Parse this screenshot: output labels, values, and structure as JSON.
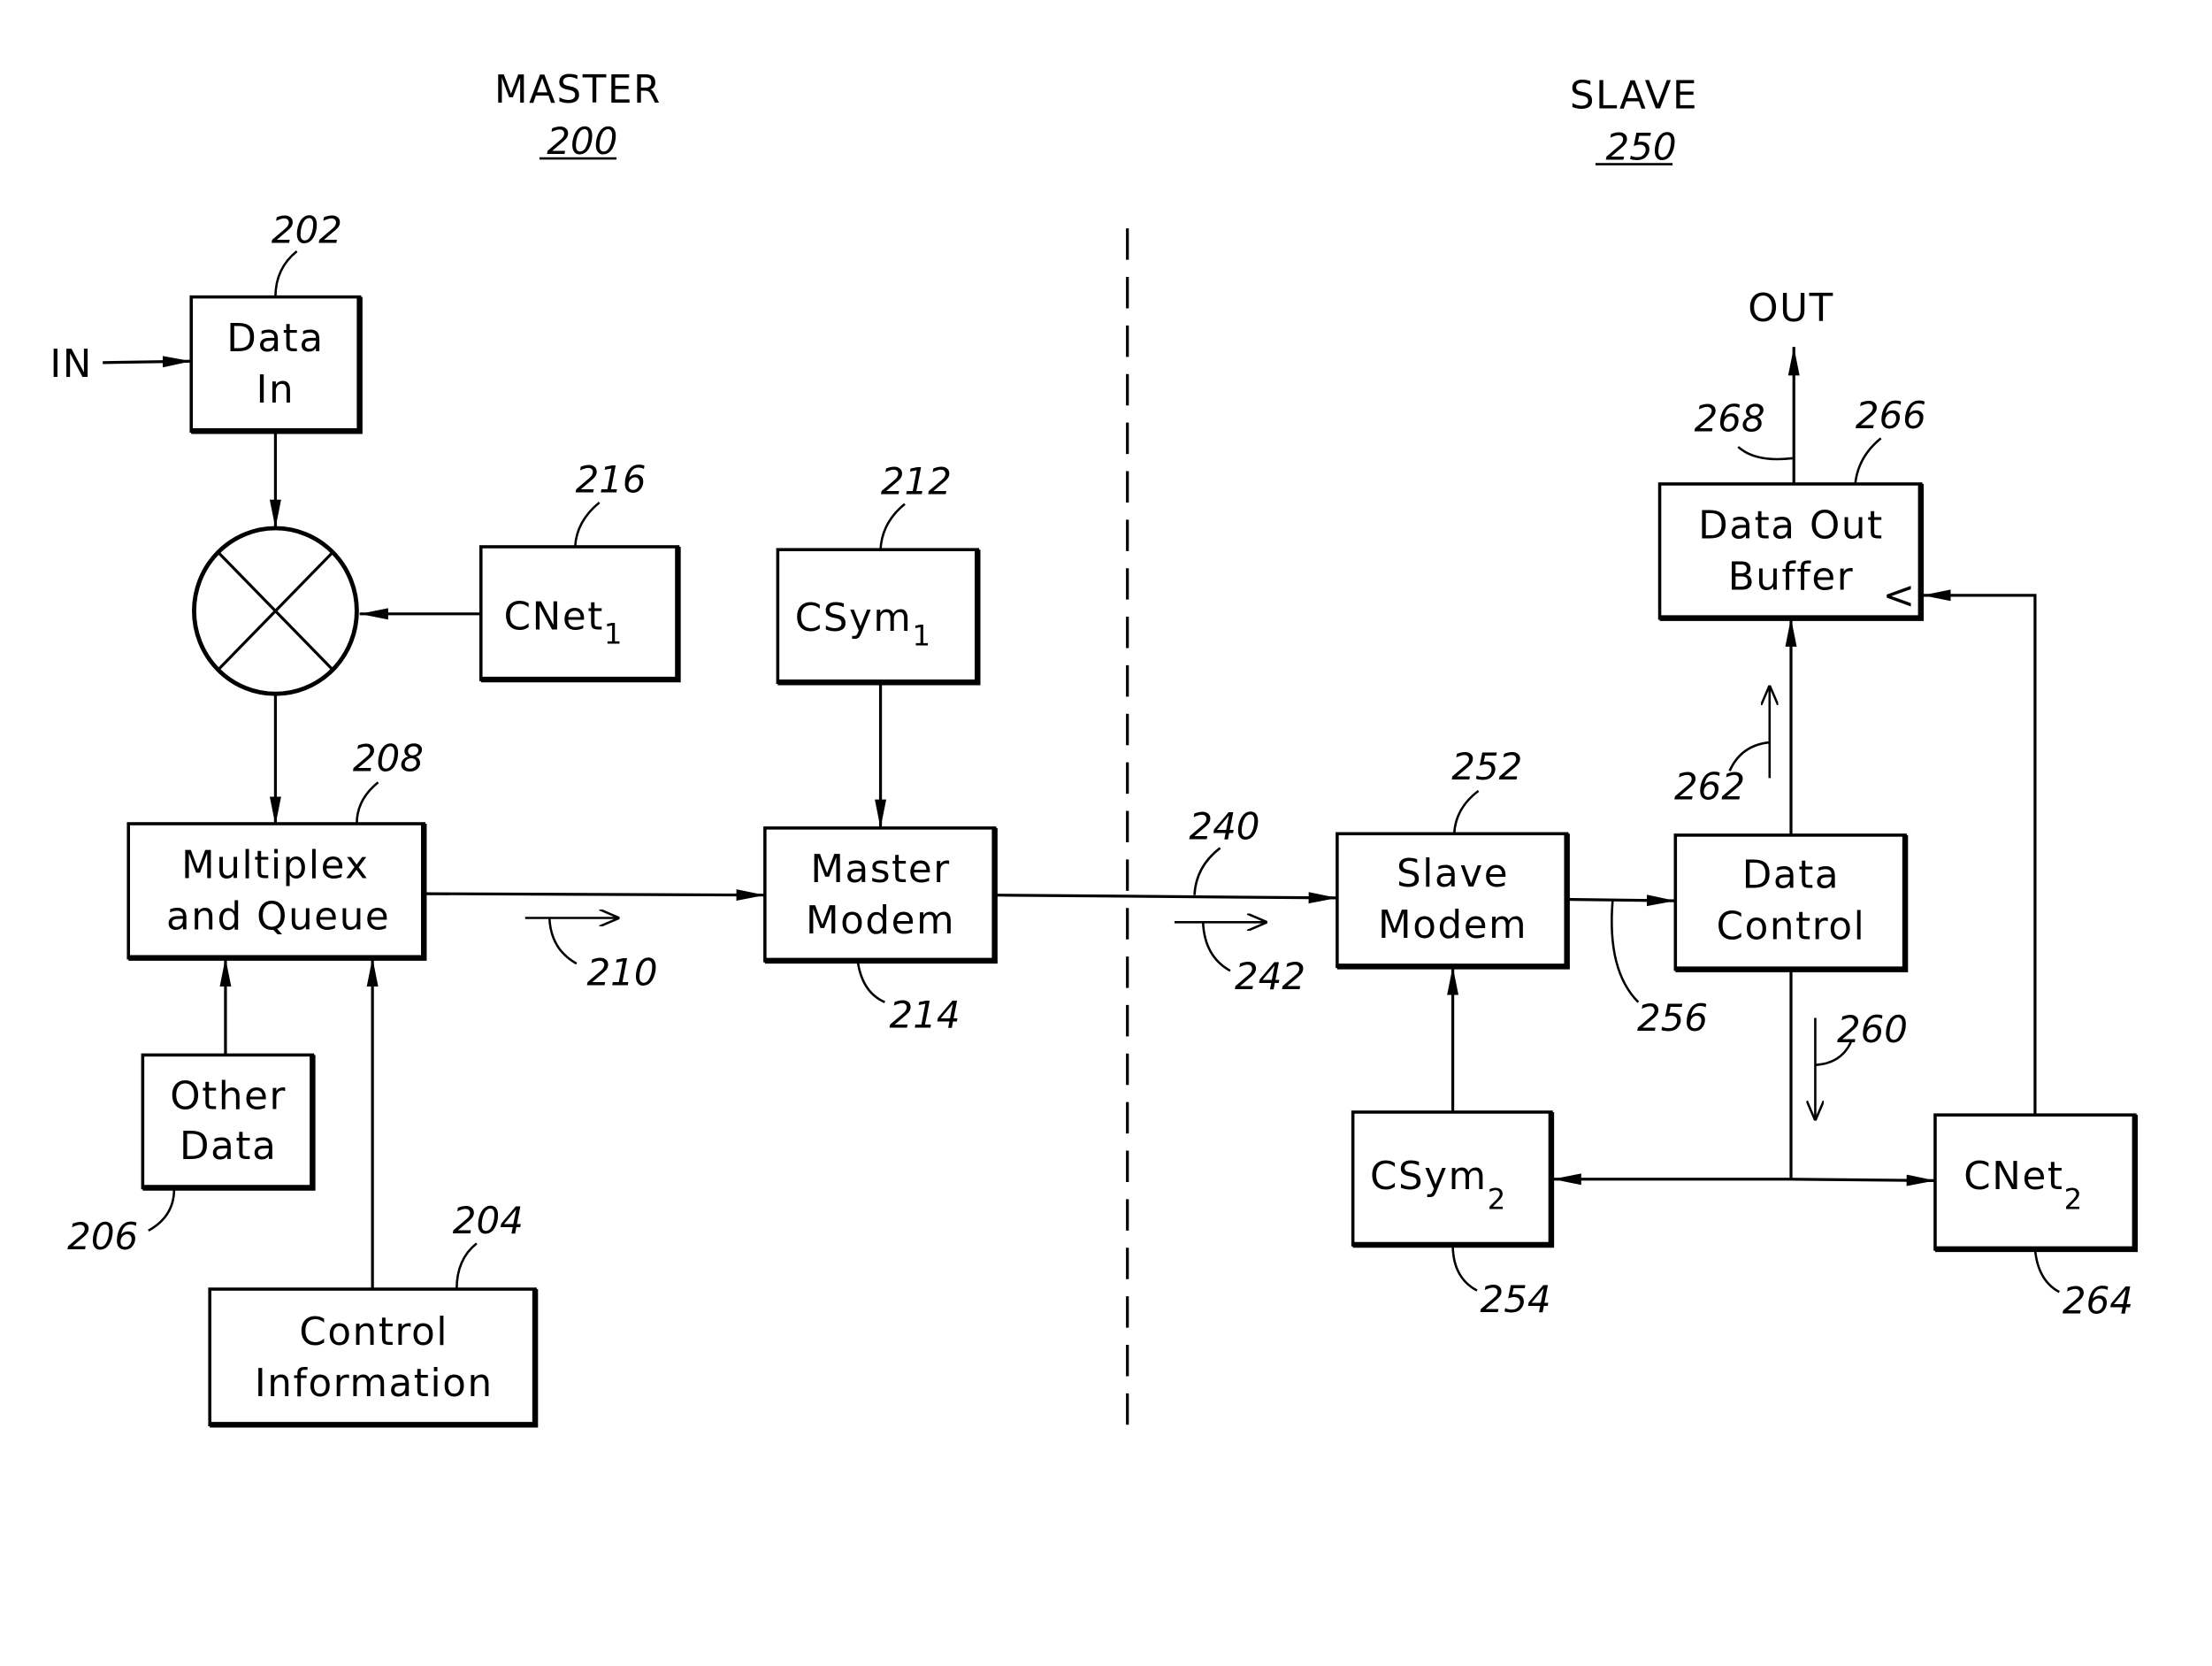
{
  "sections": {
    "master": {
      "title": "MASTER",
      "ref": "200"
    },
    "slave": {
      "title": "SLAVE",
      "ref": "250"
    }
  },
  "terminals": {
    "in": "IN",
    "out": "OUT"
  },
  "blocks": {
    "data_in": {
      "line1": "Data",
      "line2": "In",
      "ref": "202"
    },
    "cnet1": {
      "base": "CNet",
      "subscript": "1",
      "ref": "216"
    },
    "csym1": {
      "base": "CSym",
      "subscript": "1",
      "ref": "212"
    },
    "multiplex": {
      "line1": "Multiplex",
      "line2": "and  Queue",
      "ref": "208"
    },
    "master_modem": {
      "line1": "Master",
      "line2": "Modem",
      "ref": "214"
    },
    "other_data": {
      "line1": "Other",
      "line2": "Data",
      "ref": "206"
    },
    "control_info": {
      "line1": "Control",
      "line2": "Information",
      "ref": "204"
    },
    "slave_modem": {
      "line1": "Slave",
      "line2": "Modem",
      "ref": "252"
    },
    "data_control": {
      "line1": "Data",
      "line2": "Control",
      "ref": ""
    },
    "data_out_buffer": {
      "line1": "Data  Out",
      "line2": "Buffer",
      "ref": "266",
      "clock_mark": "<"
    },
    "csym2": {
      "base": "CSym",
      "subscript": "2",
      "ref": "254"
    },
    "cnet2": {
      "base": "CNet",
      "subscript": "2",
      "ref": "264"
    }
  },
  "signal_refs": {
    "queue_to_modem": "210",
    "link": "240",
    "link_direction": "242",
    "modem_to_control": "256",
    "control_down": "260",
    "control_up": "262",
    "out_line": "268"
  }
}
